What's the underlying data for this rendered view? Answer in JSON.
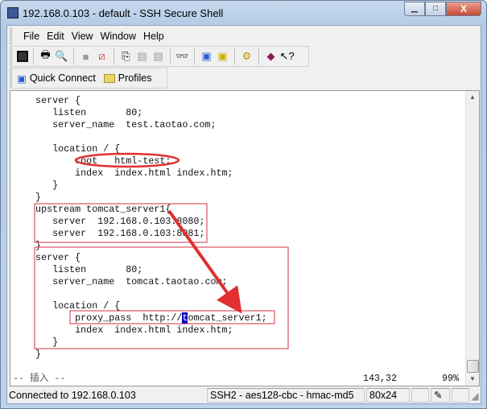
{
  "window": {
    "title": "192.168.0.103 - default - SSH Secure Shell",
    "minimize": "▁",
    "maximize": "□",
    "close": "X"
  },
  "menu": [
    "File",
    "Edit",
    "View",
    "Window",
    "Help"
  ],
  "toolbar": {
    "icons": [
      "save-icon",
      "print-icon",
      "print-preview-icon",
      "disconnect-icon",
      "settings-disabled-icon",
      "copy-icon",
      "paste-icon",
      "paste-disabled-icon",
      "find-icon",
      "new-terminal-icon",
      "new-file-transfer-icon",
      "profile-settings-icon",
      "help-book-icon",
      "context-help-icon"
    ]
  },
  "quickbar": {
    "quick_connect": "Quick Connect",
    "profiles": "Profiles"
  },
  "terminal": {
    "lines": [
      "    server {",
      "       listen       80;",
      "       server_name  test.taotao.com;",
      "",
      "       location / {",
      "           root   html-test;",
      "           index  index.html index.htm;",
      "       }",
      "    }",
      "    upstream tomcat_server1{",
      "       server  192.168.0.103:8080;",
      "       server  192.168.0.103:8081;",
      "    }",
      "    server {",
      "       listen       80;",
      "       server_name  tomcat.taotao.com;",
      "",
      "       location / {"
    ],
    "proxy_line_before": "           proxy_pass  http://",
    "cursor_char": "t",
    "proxy_line_after": "omcat_server1;",
    "lines_after": [
      "           index  index.html index.htm;",
      "       }",
      "    }"
    ],
    "mode": "-- 插入 --",
    "position": "143,32",
    "percent": "99%"
  },
  "statusbar": {
    "connection": "Connected to 192.168.0.103",
    "cipher": "SSH2 - aes128-cbc - hmac-md5",
    "size": "80x24"
  },
  "annotation_color": "#e03030"
}
